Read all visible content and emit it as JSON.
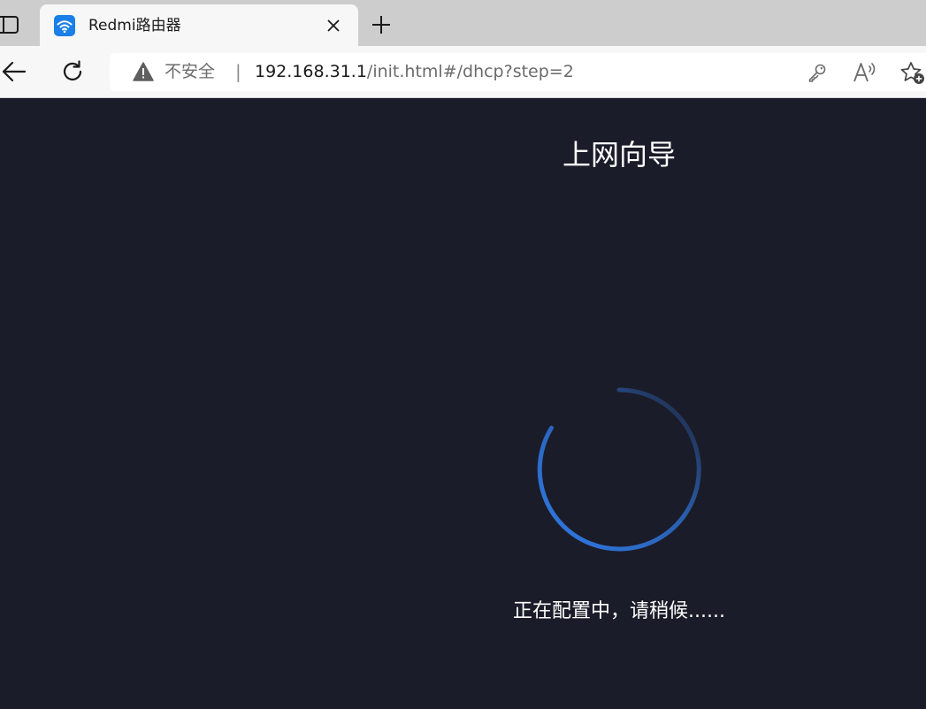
{
  "browser": {
    "tab": {
      "title": "Redmi路由器",
      "favicon": "wifi-icon"
    },
    "address_bar": {
      "security_label": "不安全",
      "separator": "|",
      "url_host": "192.168.31.1",
      "url_path": "/init.html#/dhcp?step=2"
    },
    "icons": {
      "tab_actions": "tab-actions-icon",
      "close": "close-icon",
      "new_tab": "plus-icon",
      "back": "back-arrow-icon",
      "refresh": "refresh-icon",
      "warning": "warning-icon",
      "password": "key-icon",
      "read_aloud": "read-aloud-icon",
      "favorites": "add-favorite-icon"
    }
  },
  "page": {
    "title": "上网向导",
    "status": "正在配置中，请稍候......",
    "spinner_icon": "loading-spinner-icon"
  },
  "colors": {
    "page_background": "#1b1c29",
    "spinner_accent": "#2f7be6",
    "tab_strip": "#cdcdcd",
    "favicon_blue": "#1a7fe6"
  }
}
